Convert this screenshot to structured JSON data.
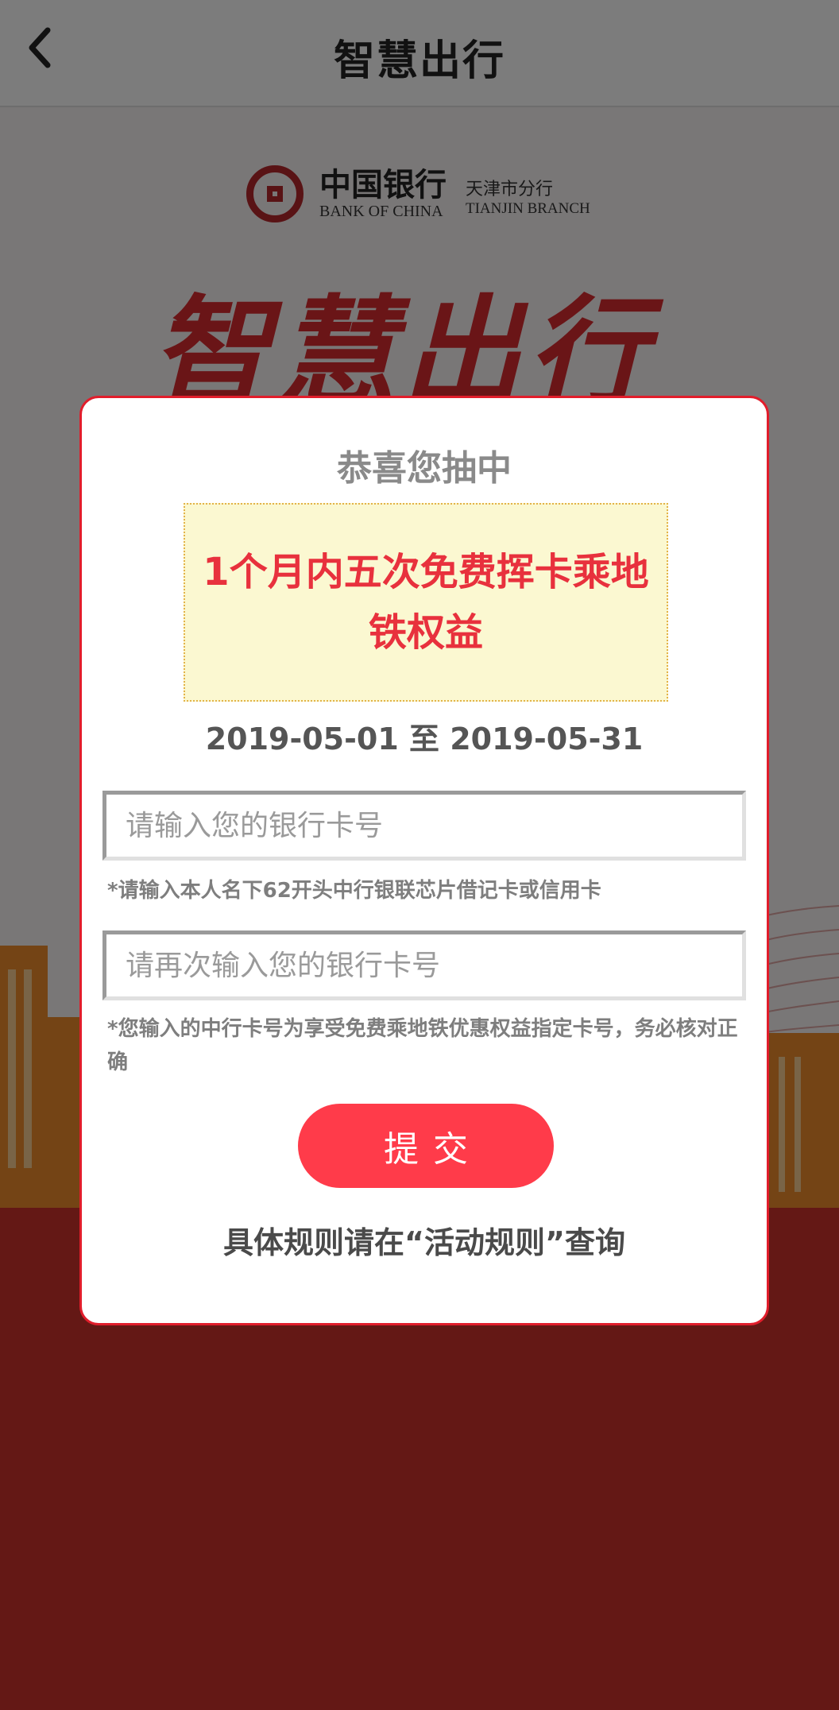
{
  "header": {
    "title": "智慧出行",
    "back_icon": "chevron-left-icon"
  },
  "background": {
    "bank_name_cn": "中国银行",
    "bank_name_en": "BANK OF CHINA",
    "branch_cn": "天津市分行",
    "branch_en": "TIANJIN BRANCH",
    "hero_title": "智慧出行",
    "colors": {
      "brand_red": "#b3262b",
      "hero_red": "#d52a2f",
      "bottom_red": "#c8302a"
    }
  },
  "modal": {
    "congrats": "恭喜您抽中",
    "prize": "1个月内五次免费挥卡乘地铁权益",
    "period": "2019-05-01 至 2019-05-31",
    "card_input_placeholder": "请输入您的银行卡号",
    "card_input_hint": "*请输入本人名下62开头中行银联芯片借记卡或信用卡",
    "card_confirm_placeholder": "请再次输入您的银行卡号",
    "card_confirm_hint": "*您输入的中行卡号为享受免费乘地铁优惠权益指定卡号，务必核对正确",
    "submit_label": "提交",
    "rules_text": "具体规则请在“活动规则”查询",
    "colors": {
      "border": "#e11d2b",
      "prize_text": "#e8313d",
      "prize_bg": "#fbf8d1",
      "submit_bg": "#ff3b4a"
    }
  }
}
